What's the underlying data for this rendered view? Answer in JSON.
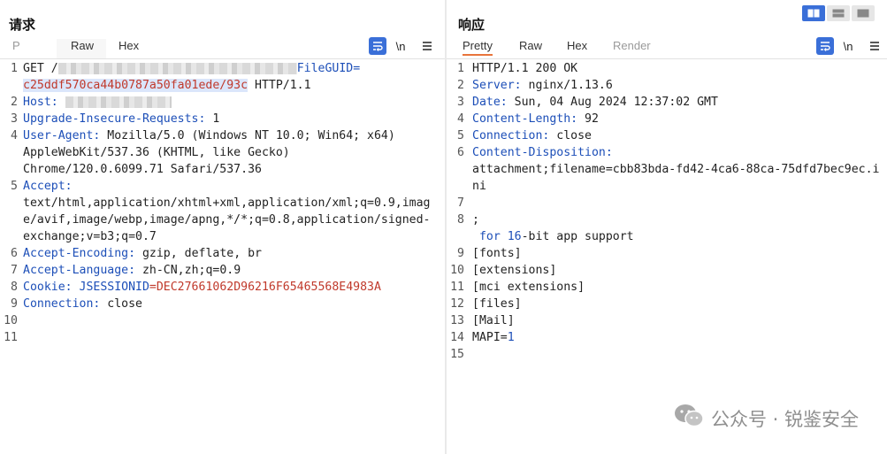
{
  "request": {
    "title": "请求",
    "tabs": [
      "P",
      "Raw",
      "Hex"
    ],
    "active_tab": "Raw",
    "tools": {
      "wrap_icon": "wrap-icon",
      "newline_label": "\\n",
      "menu_icon": "menu-icon"
    },
    "lines": [
      {
        "n": "1",
        "a": "GET /",
        "b": "FileGUID=",
        "c": ""
      },
      {
        "n": "",
        "a": "c25ddf570ca44b0787a50fa01ede/93c",
        "b": " HTTP/1.1",
        "c": ""
      },
      {
        "n": "2",
        "a": "Host:",
        "b": "",
        "c": ""
      },
      {
        "n": "3",
        "a": "Upgrade-Insecure-Requests:",
        "b": " 1",
        "c": ""
      },
      {
        "n": "4",
        "a": "User-Agent:",
        "b": " Mozilla/5.0 (Windows NT 10.0; Win64; x64)",
        "c": ""
      },
      {
        "n": "",
        "a": "",
        "b": "AppleWebKit/537.36 (KHTML, like Gecko)",
        "c": ""
      },
      {
        "n": "",
        "a": "",
        "b": "Chrome/120.0.6099.71 Safari/537.36",
        "c": ""
      },
      {
        "n": "5",
        "a": "Accept:",
        "b": "",
        "c": ""
      },
      {
        "n": "",
        "a": "",
        "b": "text/html,application/xhtml+xml,application/xml;q=0.9,imag",
        "c": ""
      },
      {
        "n": "",
        "a": "",
        "b": "e/avif,image/webp,image/apng,*/*;q=0.8,application/signed-",
        "c": ""
      },
      {
        "n": "",
        "a": "",
        "b": "exchange;v=b3;q=0.7",
        "c": ""
      },
      {
        "n": "6",
        "a": "Accept-Encoding:",
        "b": " gzip, deflate, br",
        "c": ""
      },
      {
        "n": "7",
        "a": "Accept-Language:",
        "b": " zh-CN,zh;q=0.9",
        "c": ""
      },
      {
        "n": "8",
        "a": "Cookie:",
        "b": " JSESSIONID",
        "c": "=DEC27661062D96216F65465568E4983A"
      },
      {
        "n": "9",
        "a": "Connection:",
        "b": " close",
        "c": ""
      },
      {
        "n": "10",
        "a": "",
        "b": "",
        "c": ""
      },
      {
        "n": "11",
        "a": "",
        "b": "",
        "c": ""
      }
    ]
  },
  "response": {
    "title": "响应",
    "tabs": [
      "Pretty",
      "Raw",
      "Hex",
      "Render"
    ],
    "active_tab": "Pretty",
    "tools": {
      "wrap_icon": "wrap-icon",
      "newline_label": "\\n",
      "menu_icon": "menu-icon"
    },
    "lines": [
      {
        "n": "1",
        "a": "",
        "b": "HTTP/1.1 200 OK",
        "c": ""
      },
      {
        "n": "2",
        "a": "Server:",
        "b": " nginx/1.13.6",
        "c": ""
      },
      {
        "n": "3",
        "a": "Date:",
        "b": " Sun, 04 Aug 2024 12:37:02 GMT",
        "c": ""
      },
      {
        "n": "4",
        "a": "Content-Length:",
        "b": " 92",
        "c": ""
      },
      {
        "n": "5",
        "a": "Connection:",
        "b": " close",
        "c": ""
      },
      {
        "n": "6",
        "a": "Content-Disposition:",
        "b": "",
        "c": ""
      },
      {
        "n": "",
        "a": "",
        "b": "attachment;filename=cbb83bda-fd42-4ca6-88ca-75dfd7bec9ec.i",
        "c": ""
      },
      {
        "n": "",
        "a": "",
        "b": "ni",
        "c": ""
      },
      {
        "n": "7",
        "a": "",
        "b": "",
        "c": ""
      },
      {
        "n": "8",
        "a": "",
        "b": ";",
        "c": ""
      },
      {
        "n": "",
        "a": "",
        "b": " for ",
        "c": "16-bit app support"
      },
      {
        "n": "9",
        "a": "",
        "b": "[fonts]",
        "c": ""
      },
      {
        "n": "10",
        "a": "",
        "b": "[extensions]",
        "c": ""
      },
      {
        "n": "11",
        "a": "",
        "b": "[mci extensions]",
        "c": ""
      },
      {
        "n": "12",
        "a": "",
        "b": "[files]",
        "c": ""
      },
      {
        "n": "13",
        "a": "",
        "b": "[Mail]",
        "c": ""
      },
      {
        "n": "14",
        "a": "",
        "b": "MAPI=",
        "c": "1"
      },
      {
        "n": "15",
        "a": "",
        "b": "",
        "c": ""
      }
    ]
  },
  "layout_icons": [
    "split-horizontal-icon",
    "split-vertical-icon",
    "single-pane-icon"
  ],
  "watermark": {
    "text": "公众号 · 锐鉴安全",
    "icon": "wechat-icon"
  },
  "colors": {
    "key_blue": "#1d4fb8",
    "value_red": "#c0392b",
    "accent_orange": "#e8743b",
    "button_blue": "#3a6fd8"
  }
}
